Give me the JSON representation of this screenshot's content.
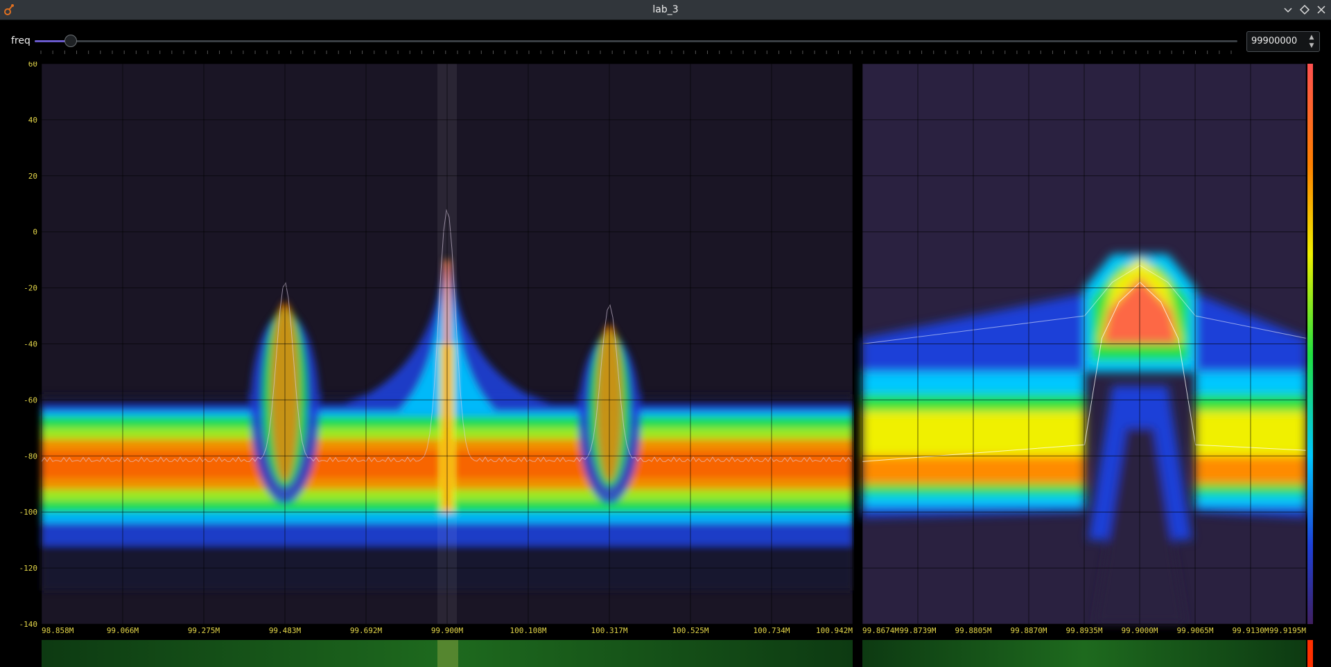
{
  "window": {
    "title": "lab_3",
    "icons": {
      "app": "gnuradio-icon",
      "minimize": "chevron-down-icon",
      "maximize": "diamond-icon",
      "close": "close-icon"
    }
  },
  "toolbar": {
    "freq_label": "freq",
    "freq_value": "99900000",
    "slider_fraction": 0.025
  },
  "chart_data": [
    {
      "type": "area",
      "name": "spectrum-wide",
      "yticks": [
        60,
        40,
        20,
        0,
        -20,
        -40,
        -60,
        -80,
        -100,
        -120,
        -140
      ],
      "ylim": [
        -140,
        60
      ],
      "xticks": [
        "98.858M",
        "99.066M",
        "99.275M",
        "99.483M",
        "99.692M",
        "99.900M",
        "100.108M",
        "100.317M",
        "100.525M",
        "100.734M",
        "100.942M"
      ],
      "xlim_mhz": [
        98.858,
        100.942
      ],
      "noise_floor_db": -82,
      "peaks": [
        {
          "center_mhz": 99.483,
          "peak_db": -36
        },
        {
          "center_mhz": 99.9,
          "peak_db": -10
        },
        {
          "center_mhz": 100.317,
          "peak_db": -44
        }
      ],
      "grid": true,
      "colormap": [
        "#1a1630",
        "#1e40d8",
        "#00c8ff",
        "#20e040",
        "#f0f000",
        "#ff8000",
        "#ff3000"
      ]
    },
    {
      "type": "area",
      "name": "spectrum-zoom",
      "xticks": [
        "99.8674M",
        "99.8739M",
        "99.8805M",
        "99.8870M",
        "99.8935M",
        "99.9000M",
        "99.9065M",
        "99.9130M",
        "99.9195M"
      ],
      "xlim_mhz": [
        99.8674,
        99.9195
      ],
      "center_mhz": 99.9,
      "peak_db": -9,
      "grid": true,
      "colorbar": [
        "#ff5050",
        "#ff8000",
        "#f0f000",
        "#20e040",
        "#00c8ff",
        "#1e40d8",
        "#402060"
      ]
    }
  ]
}
